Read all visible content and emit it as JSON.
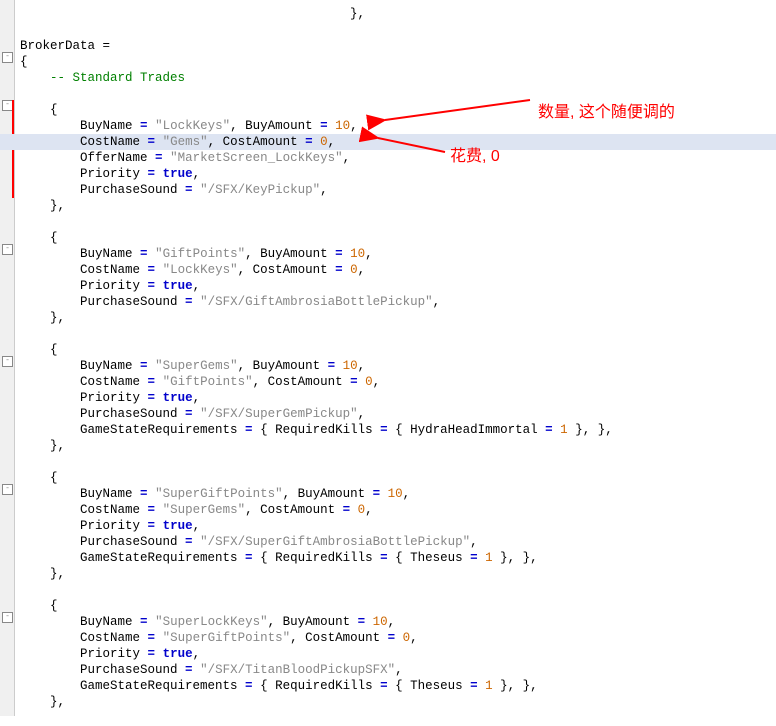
{
  "header": {
    "var": "BrokerData",
    "assign": "="
  },
  "comment": "-- Standard Trades",
  "trades": [
    {
      "BuyName": "\"LockKeys\"",
      "BuyAmount": "10",
      "CostName": "\"Gems\"",
      "CostAmount": "0",
      "OfferName": "\"MarketScreen_LockKeys\"",
      "Priority": "true",
      "PurchaseSound": "\"/SFX/KeyPickup\"",
      "GameStateReq": null,
      "Boss": null,
      "BossVal": null
    },
    {
      "BuyName": "\"GiftPoints\"",
      "BuyAmount": "10",
      "CostName": "\"LockKeys\"",
      "CostAmount": "0",
      "OfferName": null,
      "Priority": "true",
      "PurchaseSound": "\"/SFX/GiftAmbrosiaBottlePickup\"",
      "GameStateReq": null,
      "Boss": null,
      "BossVal": null
    },
    {
      "BuyName": "\"SuperGems\"",
      "BuyAmount": "10",
      "CostName": "\"GiftPoints\"",
      "CostAmount": "0",
      "OfferName": null,
      "Priority": "true",
      "PurchaseSound": "\"/SFX/SuperGemPickup\"",
      "GameStateReq": "GameStateRequirements",
      "Boss": "HydraHeadImmortal",
      "BossVal": "1"
    },
    {
      "BuyName": "\"SuperGiftPoints\"",
      "BuyAmount": "10",
      "CostName": "\"SuperGems\"",
      "CostAmount": "0",
      "OfferName": null,
      "Priority": "true",
      "PurchaseSound": "\"/SFX/SuperGiftAmbrosiaBottlePickup\"",
      "GameStateReq": "GameStateRequirements",
      "Boss": "Theseus",
      "BossVal": "1"
    },
    {
      "BuyName": "\"SuperLockKeys\"",
      "BuyAmount": "10",
      "CostName": "\"SuperGiftPoints\"",
      "CostAmount": "0",
      "OfferName": null,
      "Priority": "true",
      "PurchaseSound": "\"/SFX/TitanBloodPickupSFX\"",
      "GameStateReq": "GameStateRequirements",
      "Boss": "Theseus",
      "BossVal": "1"
    }
  ],
  "annotations": {
    "amount": "数量, 这个随便调的",
    "cost": "花费, 0"
  }
}
